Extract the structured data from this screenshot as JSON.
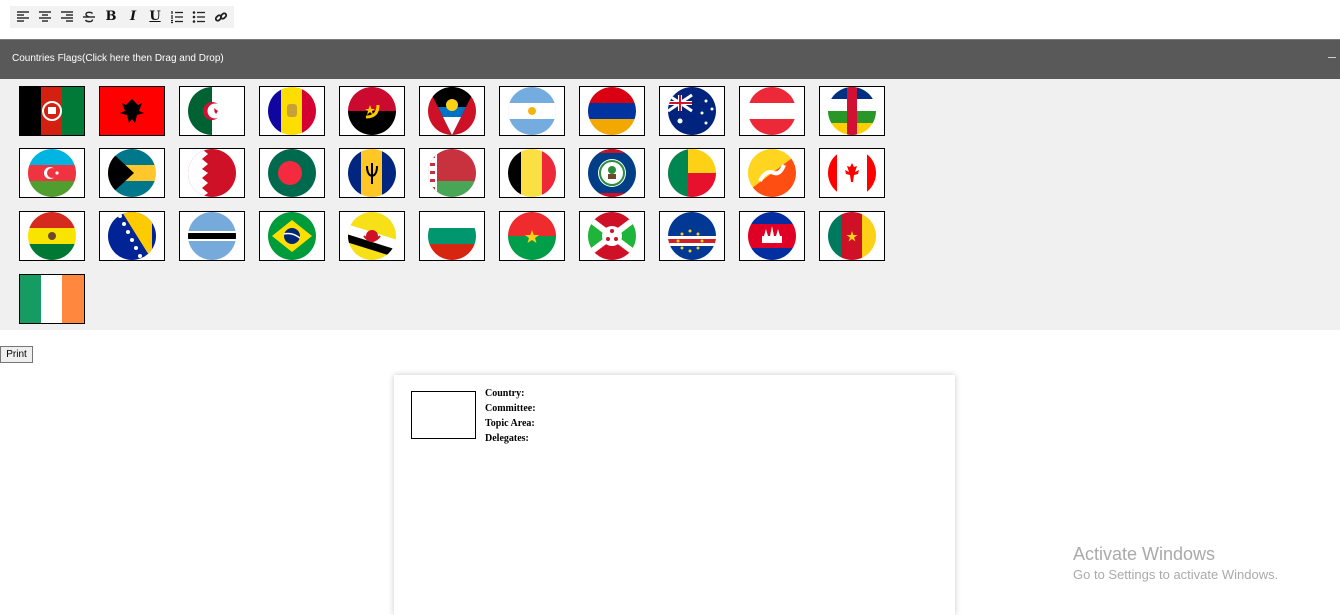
{
  "toolbar": {
    "bold": "B",
    "italic": "I",
    "underline": "U"
  },
  "panel": {
    "title": "Countries Flags(Click here then Drag and Drop)"
  },
  "flags": [
    "afghanistan",
    "albania",
    "algeria",
    "andorra",
    "angola",
    "antigua-and-barbuda",
    "argentina",
    "armenia",
    "australia",
    "austria",
    "central-african-republic",
    "azerbaijan",
    "bahamas",
    "bahrain",
    "bangladesh",
    "barbados",
    "belarus",
    "belgium",
    "belize",
    "benin",
    "bhutan",
    "canada",
    "bolivia",
    "bosnia-and-herzegovina",
    "botswana",
    "brazil",
    "brunei",
    "bulgaria",
    "burkina-faso",
    "burundi",
    "cape-verde",
    "cambodia",
    "cameroon",
    "ireland"
  ],
  "print_label": "Print",
  "card": {
    "country_label": "Country:",
    "committee_label": "Committee:",
    "topic_label": "Topic Area:",
    "delegates_label": "Delegates:"
  },
  "watermark": {
    "line1": "Activate Windows",
    "line2": "Go to Settings to activate Windows."
  }
}
